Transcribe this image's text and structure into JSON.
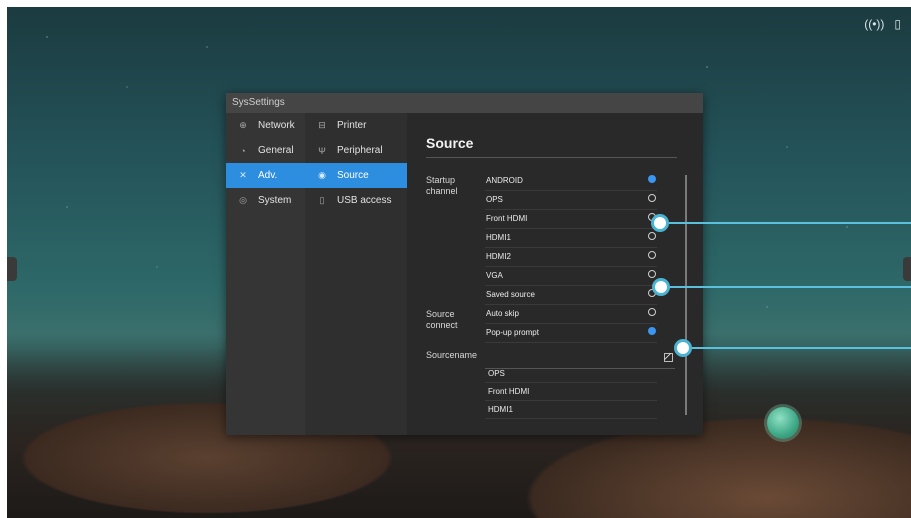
{
  "dialog": {
    "title": "SysSettings"
  },
  "nav_primary": [
    {
      "label": "Network",
      "icon": "globe-icon",
      "active": false
    },
    {
      "label": "General",
      "icon": "palette-icon",
      "active": false
    },
    {
      "label": "Adv.",
      "icon": "tools-icon",
      "active": true
    },
    {
      "label": "System",
      "icon": "gear-icon",
      "active": false
    }
  ],
  "nav_secondary": [
    {
      "label": "Printer",
      "icon": "printer-icon",
      "active": false
    },
    {
      "label": "Peripheral",
      "icon": "usb-icon",
      "active": false
    },
    {
      "label": "Source",
      "icon": "source-icon",
      "active": true
    },
    {
      "label": "USB access",
      "icon": "usb-drive-icon",
      "active": false
    }
  ],
  "content": {
    "title": "Source",
    "startup_label_line1": "Startup",
    "startup_label_line2": "channel",
    "startup_options": [
      {
        "label": "ANDROID",
        "selected": true
      },
      {
        "label": "OPS",
        "selected": false
      },
      {
        "label": "Front HDMI",
        "selected": false
      },
      {
        "label": "HDMI1",
        "selected": false
      },
      {
        "label": "HDMI2",
        "selected": false
      },
      {
        "label": "VGA",
        "selected": false
      },
      {
        "label": "Saved source",
        "selected": false
      }
    ],
    "connect_label_line1": "Source",
    "connect_label_line2": "connect",
    "connect_options": [
      {
        "label": "Auto skip",
        "selected": false
      },
      {
        "label": "Pop-up prompt",
        "selected": true
      }
    ],
    "sourcename_label": "Sourcename",
    "sourcename_items": [
      "OPS",
      "Front HDMI",
      "HDMI1"
    ]
  },
  "colors": {
    "accent": "#2d8ee0",
    "callout": "#5bc0de"
  }
}
